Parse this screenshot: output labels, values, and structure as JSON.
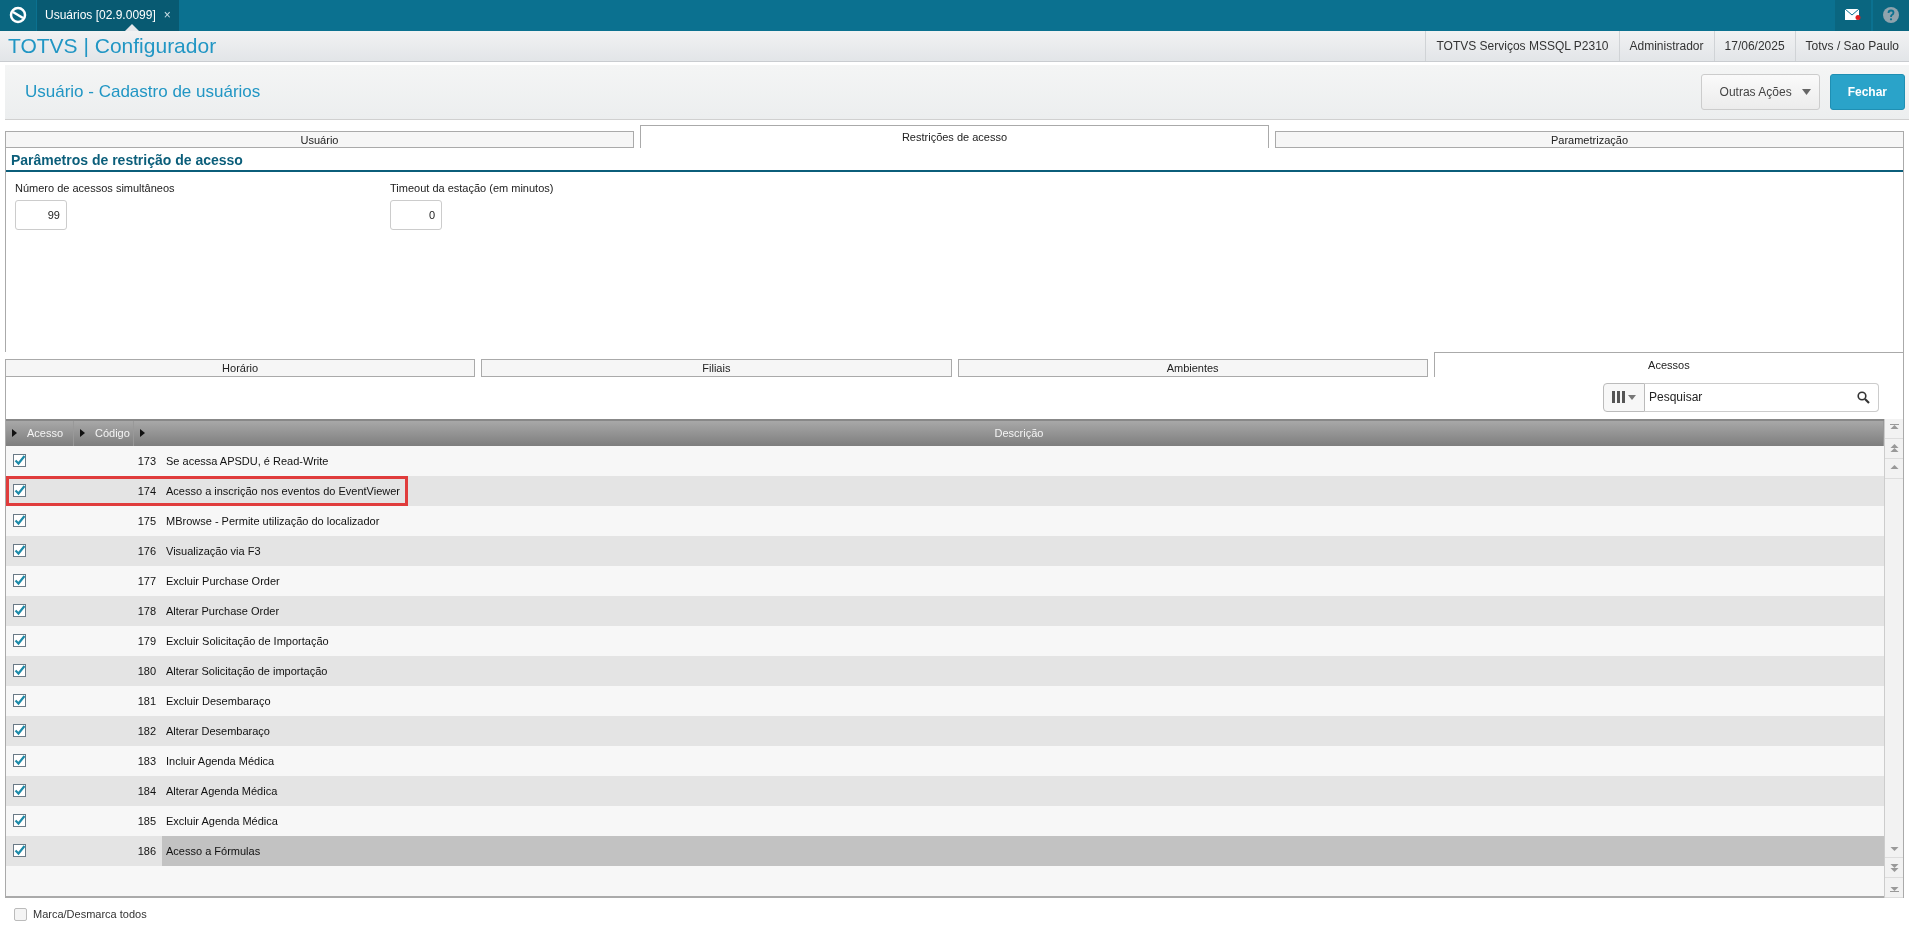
{
  "top_bar": {
    "tab": {
      "label": "Usuários [02.9.0099]",
      "close": "×",
      "selected": true
    }
  },
  "header": {
    "app_title": "TOTVS | Configurador",
    "info": [
      "TOTVS Serviços MSSQL P2310",
      "Administrador",
      "17/06/2025",
      "Totvs / Sao Paulo"
    ]
  },
  "page": {
    "title": "Usuário - Cadastro de usuários",
    "actions": [
      {
        "label": "Outras Ações",
        "kind": "dropdown"
      },
      {
        "label": "Fechar",
        "kind": "primary"
      }
    ]
  },
  "main_tabs": [
    {
      "label": "Usuário",
      "selected": false
    },
    {
      "label": "Restrições de acesso",
      "selected": true
    },
    {
      "label": "Parametrização",
      "selected": false
    }
  ],
  "section": {
    "title": "Parâmetros de restrição de acesso",
    "fields": [
      {
        "label": "Número de acessos simultâneos",
        "value": "99"
      },
      {
        "label": "Timeout da estação (em minutos)",
        "value": "0"
      }
    ]
  },
  "sub_tabs": [
    {
      "label": "Horário",
      "selected": false
    },
    {
      "label": "Filiais",
      "selected": false
    },
    {
      "label": "Ambientes",
      "selected": false
    },
    {
      "label": "Acessos",
      "selected": true
    }
  ],
  "search": {
    "placeholder": "Pesquisar"
  },
  "table": {
    "columns": [
      "Acesso",
      "Código",
      "Descrição"
    ],
    "rows": [
      {
        "checked": true,
        "code": "173",
        "description": "Se acessa APSDU, é Read-Write",
        "selected": false,
        "highlighted": false
      },
      {
        "checked": true,
        "code": "174",
        "description": "Acesso a inscrição nos eventos do EventViewer",
        "selected": false,
        "highlighted": true
      },
      {
        "checked": true,
        "code": "175",
        "description": "MBrowse - Permite utilização do localizador",
        "selected": false,
        "highlighted": false
      },
      {
        "checked": true,
        "code": "176",
        "description": "Visualização via F3",
        "selected": false,
        "highlighted": false
      },
      {
        "checked": true,
        "code": "177",
        "description": "Excluir Purchase Order",
        "selected": false,
        "highlighted": false
      },
      {
        "checked": true,
        "code": "178",
        "description": "Alterar Purchase Order",
        "selected": false,
        "highlighted": false
      },
      {
        "checked": true,
        "code": "179",
        "description": "Excluir Solicitação de Importação",
        "selected": false,
        "highlighted": false
      },
      {
        "checked": true,
        "code": "180",
        "description": "Alterar Solicitação de importação",
        "selected": false,
        "highlighted": false
      },
      {
        "checked": true,
        "code": "181",
        "description": "Excluir Desembaraço",
        "selected": false,
        "highlighted": false
      },
      {
        "checked": true,
        "code": "182",
        "description": "Alterar Desembaraço",
        "selected": false,
        "highlighted": false
      },
      {
        "checked": true,
        "code": "183",
        "description": "Incluir Agenda Médica",
        "selected": false,
        "highlighted": false
      },
      {
        "checked": true,
        "code": "184",
        "description": "Alterar Agenda Médica",
        "selected": false,
        "highlighted": false
      },
      {
        "checked": true,
        "code": "185",
        "description": "Excluir Agenda Médica",
        "selected": false,
        "highlighted": false
      },
      {
        "checked": true,
        "code": "186",
        "description": "Acesso a Fórmulas",
        "selected": true,
        "highlighted": false
      }
    ]
  },
  "footer": {
    "toggle_all": {
      "label": "Marca/Desmarca todos",
      "checked": false
    }
  }
}
